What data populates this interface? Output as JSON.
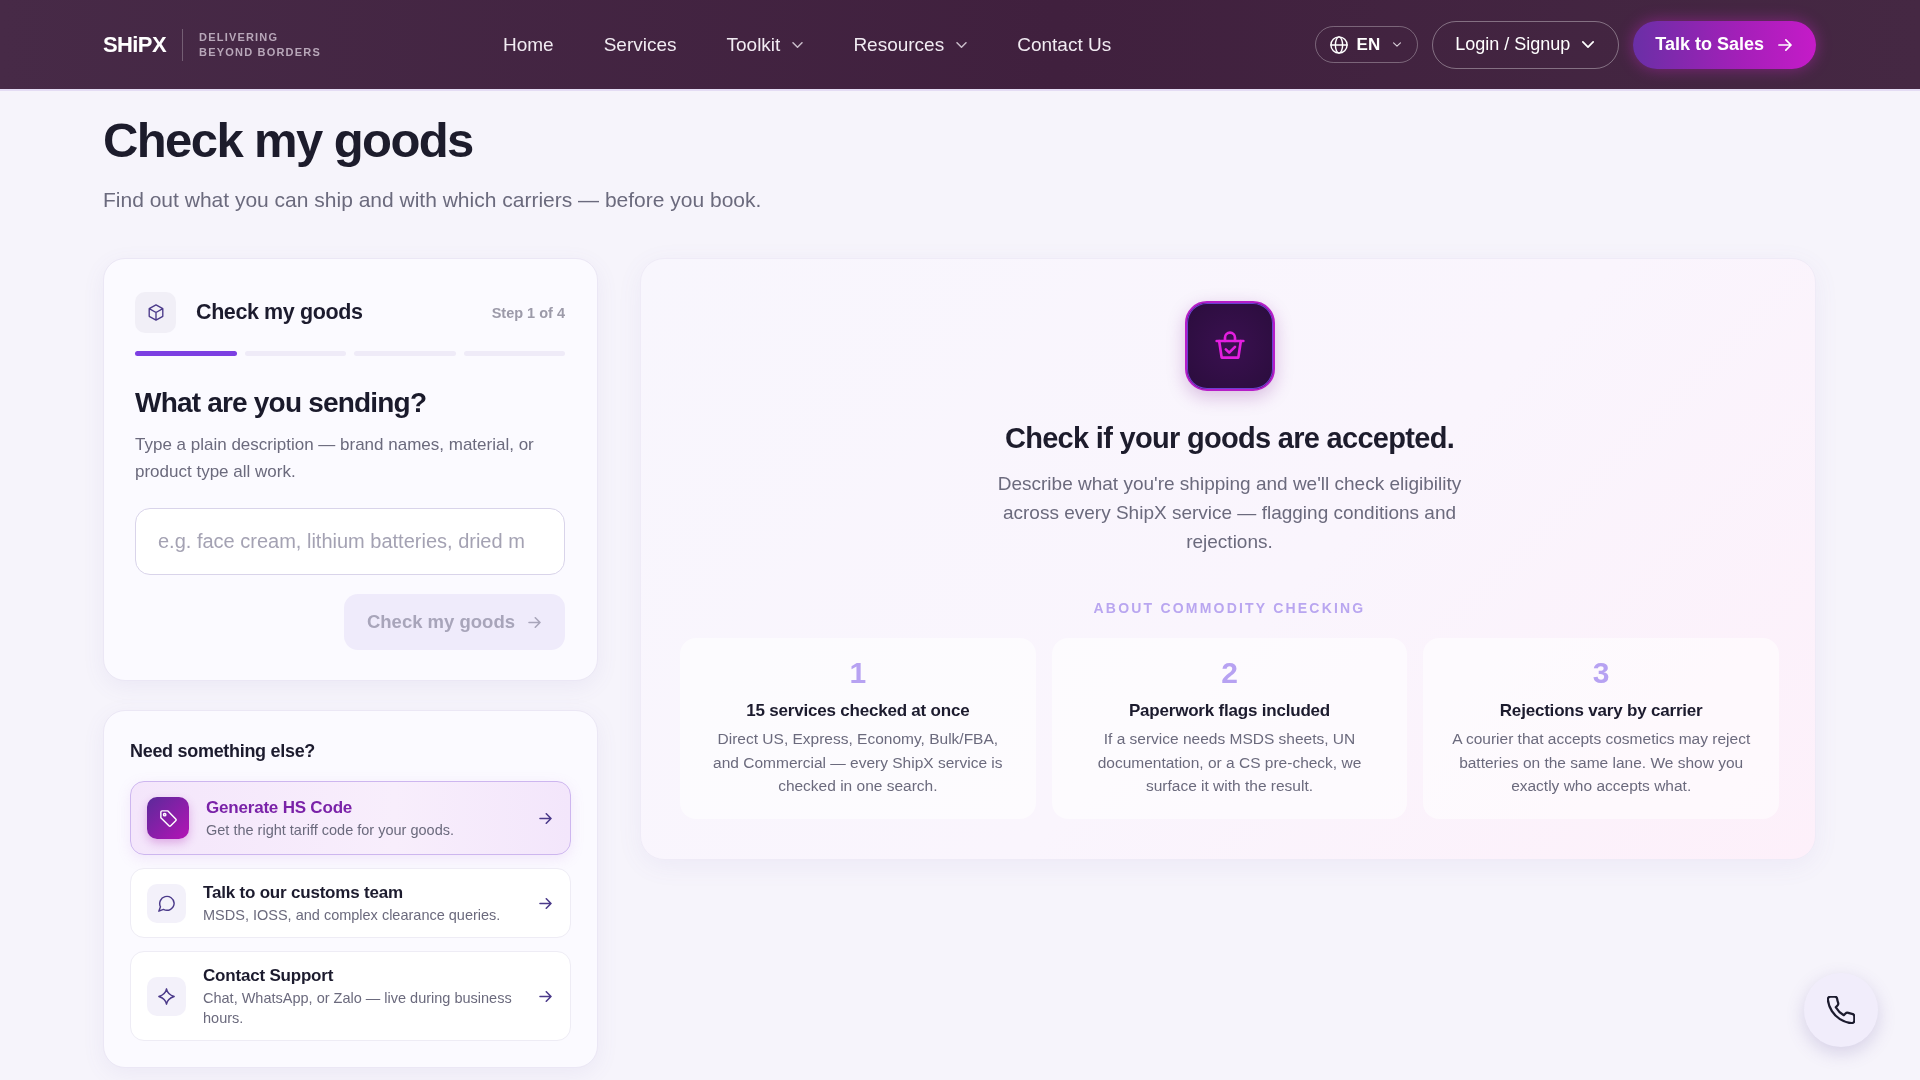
{
  "header": {
    "logo": {
      "wordmark": "SHiPX",
      "tagline": [
        "DELIVERING",
        "BEYOND BORDERS"
      ]
    },
    "nav": [
      {
        "label": "Home",
        "kind": "link"
      },
      {
        "label": "Services",
        "kind": "link"
      },
      {
        "label": "Toolkit",
        "kind": "dropdown"
      },
      {
        "label": "Resources",
        "kind": "dropdown"
      },
      {
        "label": "Contact Us",
        "kind": "link"
      }
    ],
    "language": {
      "label": "EN"
    },
    "account": {
      "label": "Login / Signup"
    },
    "cta": {
      "label": "Talk to Sales"
    }
  },
  "page": {
    "title": "Check my goods",
    "subtitle": "Find out what you can ship and with which carriers — before you book."
  },
  "wizard": {
    "title": "Check my goods",
    "step_label": "Step 1 of 4",
    "steps": [
      {
        "selected": true
      },
      {
        "selected": false
      },
      {
        "selected": false
      },
      {
        "selected": false
      }
    ],
    "question": "What are you sending?",
    "hint": "Type a plain description — brand names, material, or product type all work.",
    "input": {
      "placeholder": "e.g. face cream, lithium batteries, dried m"
    },
    "submit": {
      "label": "Check my goods",
      "disabled": true
    }
  },
  "help": {
    "title": "Need something else?",
    "items": [
      {
        "kind": "tag",
        "title": "Generate HS Code",
        "description": "Get the right tariff code for your goods.",
        "selected": true
      },
      {
        "kind": "chat",
        "title": "Talk to our customs team",
        "description": "MSDS, IOSS, and complex clearance queries.",
        "selected": false
      },
      {
        "kind": "sparkle",
        "title": "Contact Support",
        "description": "Chat, WhatsApp, or Zalo — live during business hours.",
        "selected": false
      }
    ]
  },
  "intro": {
    "title": "Check if your goods are accepted.",
    "description": "Describe what you're shipping and we'll check eligibility across every ShipX service — flagging conditions and rejections.",
    "section_label": "ABOUT COMMODITY CHECKING",
    "facts": [
      {
        "number": "1",
        "title": "15 services checked at once",
        "description": "Direct US, Express, Economy, Bulk/FBA, and Commercial — every ShipX service is checked in one search."
      },
      {
        "number": "2",
        "title": "Paperwork flags included",
        "description": "If a service needs MSDS sheets, UN documentation, or a CS pre-check, we surface it with the result."
      },
      {
        "number": "3",
        "title": "Rejections vary by carrier",
        "description": "A courier that accepts cosmetics may reject batteries on the same lane. We show you exactly who accepts what."
      }
    ]
  }
}
